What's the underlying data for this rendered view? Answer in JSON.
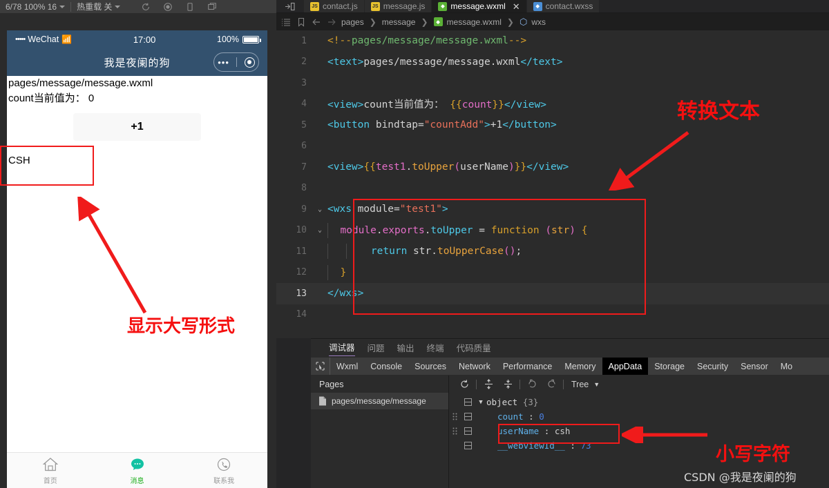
{
  "topbar": {
    "zoom_item": "6/78 100% 16",
    "preload_item": "热重载 关",
    "icons": [
      "refresh-icon",
      "record-icon",
      "phone-icon",
      "window-icon"
    ]
  },
  "simulator": {
    "status": {
      "carrier_dots": "•••••",
      "carrier": "WeChat",
      "wifi": "≈",
      "time": "17:00",
      "battery_percent": "100%"
    },
    "nav_title": "我是夜阑的狗",
    "page": {
      "path_text": "pages/message/message.wxml",
      "count_text": "count当前值为： 0",
      "button_label": "+1",
      "upper_text": "CSH"
    },
    "tabbar": [
      {
        "icon": "home-icon",
        "label": "首页",
        "active": false
      },
      {
        "icon": "message-icon",
        "label": "消息",
        "active": true
      },
      {
        "icon": "contact-icon",
        "label": "联系我",
        "active": false
      }
    ]
  },
  "editor": {
    "tabs": [
      {
        "label": "contact.js",
        "type": "js",
        "badge": "JS",
        "active": false,
        "closable": false
      },
      {
        "label": "message.js",
        "type": "js",
        "badge": "JS",
        "active": false,
        "closable": false
      },
      {
        "label": "message.wxml",
        "type": "wxml",
        "badge": "◆",
        "active": true,
        "closable": true
      },
      {
        "label": "contact.wxss",
        "type": "wxss",
        "badge": "◆",
        "active": false,
        "closable": false
      }
    ],
    "close_glyph": "✕",
    "breadcrumb": {
      "icons": [
        "outline-icon",
        "bookmark-icon",
        "back-arrow-icon",
        "forward-arrow-icon"
      ],
      "segments": [
        "pages",
        "message",
        "message.wxml",
        "wxs"
      ],
      "separator": "❯",
      "file_badge": "◆",
      "wxs_badge": "⬡"
    },
    "code_lines": [
      {
        "n": "1",
        "fold": "",
        "current": false,
        "highlight": false
      },
      {
        "n": "2",
        "fold": "",
        "current": false,
        "highlight": false
      },
      {
        "n": "3",
        "fold": "",
        "current": false,
        "highlight": false
      },
      {
        "n": "4",
        "fold": "",
        "current": false,
        "highlight": false
      },
      {
        "n": "5",
        "fold": "",
        "current": false,
        "highlight": false
      },
      {
        "n": "6",
        "fold": "",
        "current": false,
        "highlight": false
      },
      {
        "n": "7",
        "fold": "",
        "current": false,
        "highlight": false
      },
      {
        "n": "8",
        "fold": "",
        "current": false,
        "highlight": false
      },
      {
        "n": "9",
        "fold": "⌄",
        "current": false,
        "highlight": false
      },
      {
        "n": "10",
        "fold": "⌄",
        "current": false,
        "highlight": false
      },
      {
        "n": "11",
        "fold": "",
        "current": false,
        "highlight": false
      },
      {
        "n": "12",
        "fold": "",
        "current": false,
        "highlight": false
      },
      {
        "n": "13",
        "fold": "",
        "current": true,
        "highlight": true
      },
      {
        "n": "14",
        "fold": "",
        "current": false,
        "highlight": false
      }
    ],
    "code_text": {
      "l1": "<!--pages/message/message.wxml-->",
      "l2": "<text>pages/message/message.wxml</text>",
      "l4": "<view>count当前值为： {{count}}</view>",
      "l5": "<button bindtap=\"countAdd\">+1</button>",
      "l7": "<view>{{test1.toUpper(userName)}}</view>",
      "l9": "<wxs module=\"test1\">",
      "l10": "  module.exports.toUpper = function (str) {",
      "l11": "    return str.toUpperCase();",
      "l12": "  }",
      "l13": "</wxs>"
    }
  },
  "devtools": {
    "top_tabs": [
      {
        "label": "调试器",
        "active": true
      },
      {
        "label": "问题",
        "active": false
      },
      {
        "label": "输出",
        "active": false
      },
      {
        "label": "终端",
        "active": false
      },
      {
        "label": "代码质量",
        "active": false
      }
    ],
    "panel_tabs": [
      {
        "label": "Wxml",
        "active": false
      },
      {
        "label": "Console",
        "active": false
      },
      {
        "label": "Sources",
        "active": false
      },
      {
        "label": "Network",
        "active": false
      },
      {
        "label": "Performance",
        "active": false
      },
      {
        "label": "Memory",
        "active": false
      },
      {
        "label": "AppData",
        "active": true
      },
      {
        "label": "Storage",
        "active": false
      },
      {
        "label": "Security",
        "active": false
      },
      {
        "label": "Sensor",
        "active": false
      },
      {
        "label": "Mo",
        "active": false
      }
    ],
    "pages_pane": {
      "title": "Pages",
      "items": [
        "pages/message/message"
      ]
    },
    "data_toolbar": {
      "refresh": "refresh-icon",
      "expand": "expand-all-icon",
      "collapse": "collapse-all-icon",
      "undo": "undo-icon",
      "redo": "redo-icon",
      "view_mode": "Tree",
      "view_caret": "▼"
    },
    "tree": {
      "root_label": "object",
      "root_count": "{3}",
      "twisty": "▼",
      "rows": [
        {
          "key": "count",
          "sep": ":",
          "value": "0",
          "kind": "num"
        },
        {
          "key": "userName",
          "sep": ":",
          "value": "csh",
          "kind": "str"
        },
        {
          "key": "__webviewId__",
          "sep": ":",
          "value": "73",
          "kind": "num"
        }
      ]
    }
  },
  "annotations": {
    "convert_text": "转换文本",
    "show_uppercase": "显示大写形式",
    "lowercase_chars": "小写字符",
    "watermark": "CSDN @我是夜阑的狗",
    "accent_red": "#f51010"
  }
}
